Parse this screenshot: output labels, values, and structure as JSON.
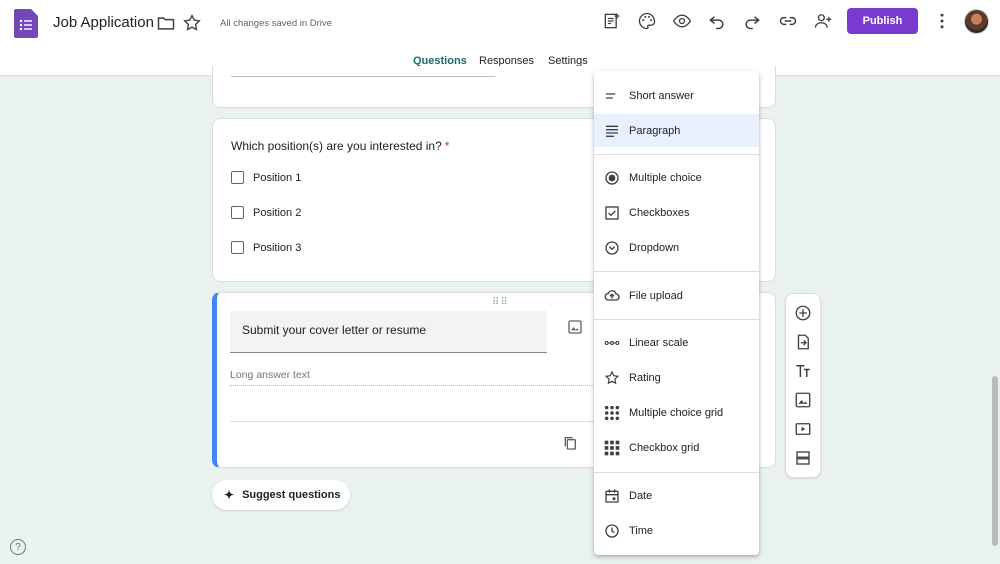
{
  "header": {
    "title": "Job Application",
    "save_status": "All changes saved in Drive",
    "publish_label": "Publish"
  },
  "tabs": [
    {
      "label": "Questions",
      "active": true
    },
    {
      "label": "Responses",
      "active": false
    },
    {
      "label": "Settings",
      "active": false
    }
  ],
  "question_card": {
    "title": "Which position(s) are you interested in?",
    "required_marker": "*",
    "options": [
      "Position 1",
      "Position 2",
      "Position 3"
    ]
  },
  "active_card": {
    "title_value": "Submit your cover letter or resume",
    "answer_placeholder": "Long answer text"
  },
  "suggest": {
    "label": "Suggest questions"
  },
  "question_type_menu": {
    "items": [
      {
        "label": "Short answer",
        "icon": "short-answer-icon"
      },
      {
        "label": "Paragraph",
        "icon": "paragraph-icon",
        "selected": true
      },
      {
        "label": "Multiple choice",
        "icon": "radio-icon"
      },
      {
        "label": "Checkboxes",
        "icon": "checkbox-icon"
      },
      {
        "label": "Dropdown",
        "icon": "dropdown-icon"
      },
      {
        "label": "File upload",
        "icon": "cloud-upload-icon"
      },
      {
        "label": "Linear scale",
        "icon": "linear-scale-icon"
      },
      {
        "label": "Rating",
        "icon": "star-icon"
      },
      {
        "label": "Multiple choice grid",
        "icon": "grid-dots-icon"
      },
      {
        "label": "Checkbox grid",
        "icon": "grid-squares-icon"
      },
      {
        "label": "Date",
        "icon": "calendar-icon"
      },
      {
        "label": "Time",
        "icon": "clock-icon"
      }
    ]
  },
  "colors": {
    "brand": "#7a3ad0",
    "accent_tab": "#1b6b62",
    "active_card_border": "#4285f4",
    "background": "#e9f2ef",
    "selected_item": "#e8f0fe"
  }
}
